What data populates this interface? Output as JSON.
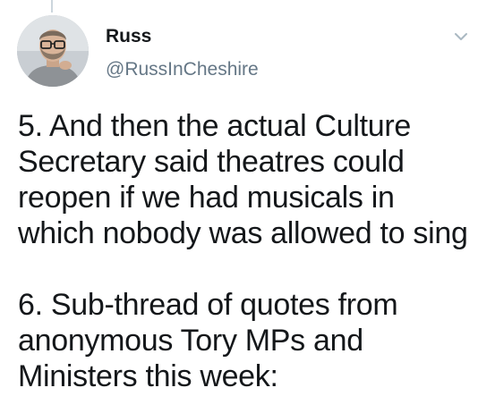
{
  "author": {
    "display_name": "Russ",
    "handle": "@RussInCheshire"
  },
  "icons": {
    "menu": "chevron-down-icon",
    "avatar": "profile-photo"
  },
  "tweet": {
    "paragraph1": [
      "5. And then the actual Culture",
      "Secretary said theatres could",
      "reopen if we had musicals in",
      "which nobody was allowed to sing"
    ],
    "paragraph2": [
      "6. Sub-thread of quotes from",
      "anonymous Tory MPs and",
      "Ministers this week:"
    ]
  },
  "colors": {
    "text": "#14171a",
    "secondary": "#657786",
    "thread_line": "#ccd6dd",
    "background": "#ffffff"
  }
}
